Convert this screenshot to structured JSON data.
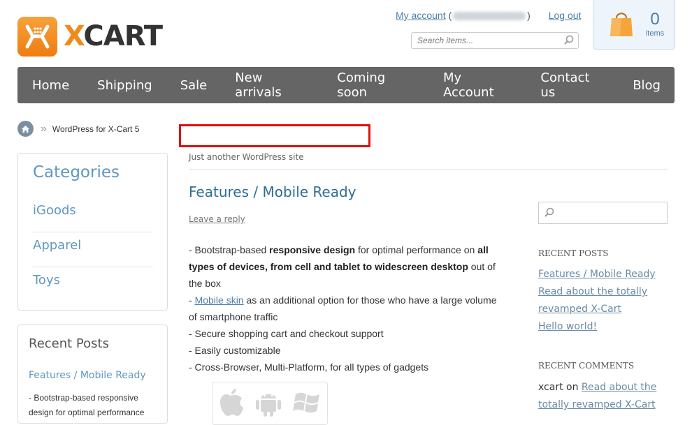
{
  "header": {
    "logo_text_x": "X",
    "logo_text_cart": "CART",
    "my_account": "My account",
    "paren_open": "(",
    "paren_close": ")",
    "logout": "Log out",
    "search_placeholder": "Search items...",
    "cart_count": "0",
    "cart_items_label": "items"
  },
  "nav": {
    "items": [
      "Home",
      "Shipping",
      "Sale",
      "New arrivals",
      "Coming soon",
      "My Account",
      "Contact us",
      "Blog"
    ]
  },
  "breadcrumb": {
    "sep": "»",
    "current": "WordPress for X-Cart 5"
  },
  "categories": {
    "title": "Categories",
    "items": [
      "iGoods",
      "Apparel",
      "Toys"
    ]
  },
  "recent_posts_box": {
    "title": "Recent Posts",
    "link": "Features / Mobile Ready",
    "excerpt": "- Bootstrap-based responsive design for optimal performance"
  },
  "blog": {
    "tagline": "Just another WordPress site"
  },
  "post": {
    "title": "Features / Mobile Ready",
    "leave_reply": "Leave a reply",
    "p1_a": "- Bootstrap-based ",
    "p1_b": "responsive design",
    "p1_c": " for optimal performance on ",
    "p1_d": "all types of devices, from cell and tablet to widescreen desktop",
    "p1_e": " out of the box",
    "p2_a": "- ",
    "p2_link": "Mobile skin",
    "p2_b": " as an additional option for those who have a large volume of smartphone traffic",
    "p3": "- Secure shopping cart and checkout support",
    "p4": "- Easily customizable",
    "p5": "- Cross-Browser, Multi-Platform, for all types of gadgets"
  },
  "sidebar": {
    "recent_posts_heading": "RECENT POSTS",
    "recent_posts": [
      "Features / Mobile Ready",
      "Read about the totally revamped X-Cart",
      "Hello world!"
    ],
    "recent_comments_heading": "RECENT COMMENTS",
    "comment_author": "xcart",
    "comment_on": " on ",
    "comment_link": "Read about the totally revamped X-Cart"
  },
  "colors": {
    "accent": "#5f97c1",
    "nav_bg": "#656565",
    "logo_orange": "#f08a1a",
    "highlight_red": "#dd1111"
  }
}
